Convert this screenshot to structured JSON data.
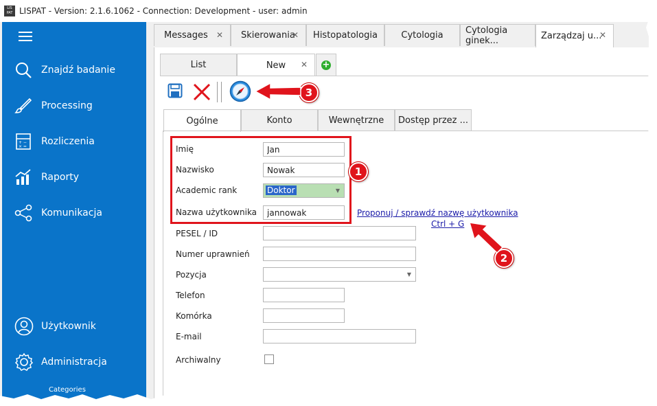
{
  "window": {
    "title": "LISPAT - Version: 2.1.6.1062 - Connection: Development - user: admin",
    "icon_text": [
      "LIS",
      "PAT"
    ]
  },
  "sidebar": {
    "items": [
      {
        "label": "Znajdź badanie",
        "icon": "search-icon"
      },
      {
        "label": "Processing",
        "icon": "brush-icon"
      },
      {
        "label": "Rozliczenia",
        "icon": "calculator-icon"
      },
      {
        "label": "Raporty",
        "icon": "chart-icon"
      },
      {
        "label": "Komunikacja",
        "icon": "share-icon"
      }
    ],
    "bottom_items": [
      {
        "label": "Użytkownik",
        "icon": "user-icon"
      },
      {
        "label": "Administracja",
        "icon": "gear-icon"
      }
    ],
    "cut_label": "Categories"
  },
  "main_tabs": [
    {
      "label": "Messages",
      "closable": true
    },
    {
      "label": "Skierowania",
      "closable": true
    },
    {
      "label": "Histopatologia",
      "closable": false
    },
    {
      "label": "Cytologia",
      "closable": false
    },
    {
      "label": "Cytologia ginek...",
      "closable": false
    },
    {
      "label": "Zarządzaj u...",
      "closable": true,
      "active": true
    }
  ],
  "sub_tabs": [
    {
      "label": "List"
    },
    {
      "label": "New",
      "closable": true,
      "active": true
    }
  ],
  "form_tabs": [
    {
      "label": "Ogólne",
      "active": true
    },
    {
      "label": "Konto"
    },
    {
      "label": "Wewnętrzne"
    },
    {
      "label": "Dostęp przez ..."
    }
  ],
  "form": {
    "first_name": {
      "label": "Imię",
      "value": "Jan"
    },
    "last_name": {
      "label": "Nazwisko",
      "value": "Nowak"
    },
    "academic_rank": {
      "label": "Academic rank",
      "value": "Doktor"
    },
    "username": {
      "label": "Nazwa użytkownika",
      "value": "jannowak"
    },
    "pesel": {
      "label": "PESEL / ID",
      "value": ""
    },
    "license_no": {
      "label": "Numer uprawnień",
      "value": ""
    },
    "position": {
      "label": "Pozycja",
      "value": ""
    },
    "phone": {
      "label": "Telefon",
      "value": ""
    },
    "mobile": {
      "label": "Komórka",
      "value": ""
    },
    "email": {
      "label": "E-mail",
      "value": ""
    },
    "archived": {
      "label": "Archiwalny",
      "checked": false
    }
  },
  "suggest_link": {
    "text": "Proponuj / sprawdź nazwę użytkownika",
    "shortcut": "Ctrl + G"
  },
  "annotations": {
    "badge_1": "1",
    "badge_2": "2",
    "badge_3": "3",
    "color": "#e0141c"
  },
  "colors": {
    "sidebar": "#0a74c9",
    "select_bg": "#b9dfb3",
    "highlight": "#2a66c9"
  }
}
